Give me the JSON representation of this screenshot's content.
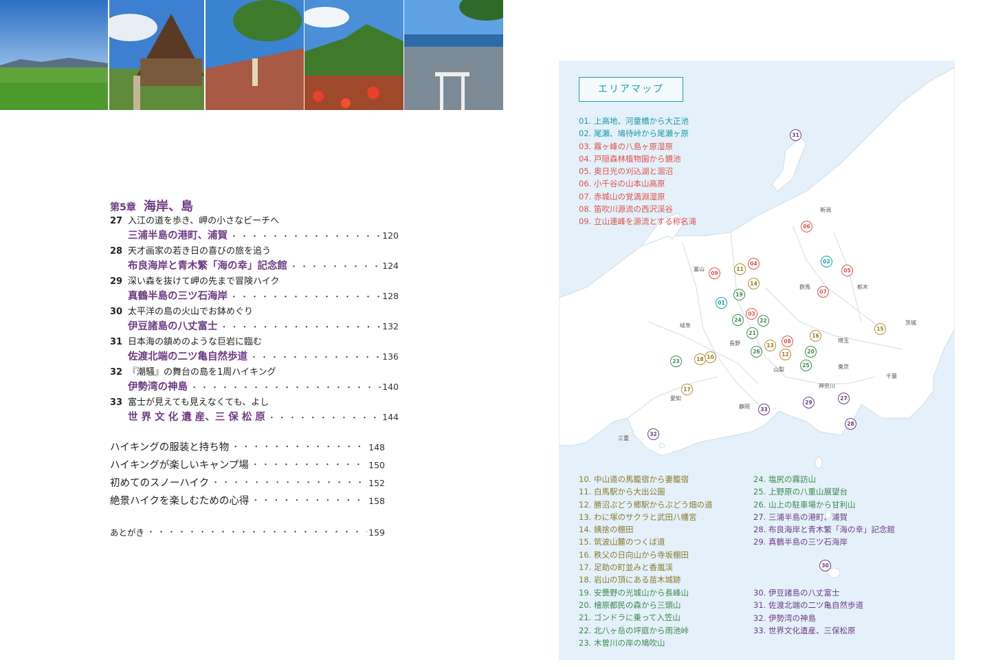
{
  "photos": [
    {
      "name": "rice-field-photo"
    },
    {
      "name": "mountain-lodge-photo"
    },
    {
      "name": "hikers-rock-photo"
    },
    {
      "name": "azalea-mountain-photo"
    },
    {
      "name": "harbor-shrine-photo"
    }
  ],
  "chapter": {
    "number": "第5章",
    "title": "海岸、島"
  },
  "entries": [
    {
      "n": "27",
      "sub": "入江の道を歩き、岬の小さなビーチへ",
      "main": "三浦半島の港町、浦賀",
      "page": "120"
    },
    {
      "n": "28",
      "sub": "天才画家の若き日の喜びの旅を追う",
      "main": "布良海岸と青木繁「海の幸」記念館",
      "page": "124"
    },
    {
      "n": "29",
      "sub": "深い森を抜けて岬の先まで冒険ハイク",
      "main": "真鶴半島の三ツ石海岸",
      "page": "128"
    },
    {
      "n": "30",
      "sub": "太平洋の島の火山でお鉢めぐり",
      "main": "伊豆諸島の八丈富士",
      "page": "132"
    },
    {
      "n": "31",
      "sub": "日本海の鎮めのような巨岩に臨む",
      "main": "佐渡北端の二ツ亀自然歩道",
      "page": "136"
    },
    {
      "n": "32",
      "sub": "『潮騒』の舞台の島を1周ハイキング",
      "main": "伊勢湾の神島",
      "page": "140"
    },
    {
      "n": "33",
      "sub": "富士が見えても見えなくても、よし",
      "main": "世 界 文 化 遺 産、三 保 松 原",
      "page": "144"
    }
  ],
  "extras": [
    {
      "label": "ハイキングの服装と持ち物",
      "page": "148"
    },
    {
      "label": "ハイキングが楽しいキャンプ場",
      "page": "150"
    },
    {
      "label": "初めてのスノーハイク",
      "page": "152"
    },
    {
      "label": "絶景ハイクを楽しむための心得",
      "page": "158"
    }
  ],
  "afterword": {
    "label": "あとがき",
    "page": "159"
  },
  "map": {
    "title": "エリアマップ",
    "legend_top": [
      {
        "text": "01. 上高地、河童橋から大正池",
        "color": "teal"
      },
      {
        "text": "02. 尾瀬、鳩待峠から尾瀬ヶ原",
        "color": "teal"
      },
      {
        "text": "03. 霧ヶ峰の八島ヶ原湿原",
        "color": "red"
      },
      {
        "text": "04. 戸隠森林植物園から鏡池",
        "color": "red"
      },
      {
        "text": "05. 奥日光の刈込湖と涸沼",
        "color": "red"
      },
      {
        "text": "06. 小千谷の山本山高原",
        "color": "red"
      },
      {
        "text": "07. 赤城山の覚満淵湿原",
        "color": "red"
      },
      {
        "text": "08. 笛吹川源流の西沢渓谷",
        "color": "red"
      },
      {
        "text": "09. 立山連峰を源流とする称名滝",
        "color": "red"
      }
    ],
    "legend_left": [
      {
        "text": "10. 中山道の馬籠宿から妻籠宿",
        "color": "olive"
      },
      {
        "text": "11. 白馬駅から大出公園",
        "color": "olive"
      },
      {
        "text": "12. 勝沼ぶどう郷駅からぶどう畑の道",
        "color": "olive"
      },
      {
        "text": "13. わに塚のサクラと武田八幡宮",
        "color": "olive"
      },
      {
        "text": "14. 姨捨の棚田",
        "color": "olive"
      },
      {
        "text": "15. 筑波山麓のつくば道",
        "color": "olive"
      },
      {
        "text": "16. 秩父の日向山から寺坂棚田",
        "color": "olive"
      },
      {
        "text": "17. 足助の町並みと香嵐渓",
        "color": "olive"
      },
      {
        "text": "18. 岩山の頂にある苗木城跡",
        "color": "olive"
      },
      {
        "text": "19. 安曇野の光城山から長峰山",
        "color": "green"
      },
      {
        "text": "20. 檜原都民の森から三頭山",
        "color": "green"
      },
      {
        "text": "21. ゴンドラに乗って入笠山",
        "color": "green"
      },
      {
        "text": "22. 北八ヶ岳の坪庭から雨池峠",
        "color": "green"
      },
      {
        "text": "23. 木曽川の岸の鳩吹山",
        "color": "green"
      }
    ],
    "legend_right_a": [
      {
        "text": "24. 塩尻の霧訪山",
        "color": "green"
      },
      {
        "text": "25. 上野原の八重山展望台",
        "color": "green"
      },
      {
        "text": "26. 山上の駐車場から甘利山",
        "color": "green"
      },
      {
        "text": "27. 三浦半島の港町、浦賀",
        "color": "purple"
      },
      {
        "text": "28. 布良海岸と青木繁「海の幸」記念館",
        "color": "purple"
      },
      {
        "text": "29. 真鶴半島の三ツ石海岸",
        "color": "purple"
      }
    ],
    "legend_right_b": [
      {
        "text": "30. 伊豆諸島の八丈富士",
        "color": "purple"
      },
      {
        "text": "31. 佐渡北端の二ツ亀自然歩道",
        "color": "purple"
      },
      {
        "text": "32. 伊勢湾の神島",
        "color": "purple"
      },
      {
        "text": "33. 世界文化遺産、三保松原",
        "color": "purple"
      }
    ],
    "prefectures": [
      "新潟",
      "富山",
      "群馬",
      "栃木",
      "岐阜",
      "長野",
      "埼玉",
      "茨城",
      "山梨",
      "東京",
      "千葉",
      "愛知",
      "神奈川",
      "静岡",
      "三重"
    ],
    "pins": [
      {
        "n": "01",
        "color": "teal"
      },
      {
        "n": "02",
        "color": "teal"
      },
      {
        "n": "03",
        "color": "red"
      },
      {
        "n": "04",
        "color": "red"
      },
      {
        "n": "05",
        "color": "red"
      },
      {
        "n": "06",
        "color": "red"
      },
      {
        "n": "07",
        "color": "red"
      },
      {
        "n": "08",
        "color": "red"
      },
      {
        "n": "09",
        "color": "red"
      },
      {
        "n": "10",
        "color": "olive"
      },
      {
        "n": "11",
        "color": "olive"
      },
      {
        "n": "12",
        "color": "olive"
      },
      {
        "n": "13",
        "color": "olive"
      },
      {
        "n": "14",
        "color": "olive"
      },
      {
        "n": "15",
        "color": "olive"
      },
      {
        "n": "16",
        "color": "olive"
      },
      {
        "n": "17",
        "color": "olive"
      },
      {
        "n": "18",
        "color": "olive"
      },
      {
        "n": "19",
        "color": "green"
      },
      {
        "n": "20",
        "color": "green"
      },
      {
        "n": "21",
        "color": "green"
      },
      {
        "n": "22",
        "color": "green"
      },
      {
        "n": "23",
        "color": "green"
      },
      {
        "n": "24",
        "color": "green"
      },
      {
        "n": "25",
        "color": "green"
      },
      {
        "n": "26",
        "color": "green"
      },
      {
        "n": "27",
        "color": "purple"
      },
      {
        "n": "28",
        "color": "purple"
      },
      {
        "n": "29",
        "color": "purple"
      },
      {
        "n": "30",
        "color": "purple"
      },
      {
        "n": "31",
        "color": "purple"
      },
      {
        "n": "32",
        "color": "purple"
      },
      {
        "n": "33",
        "color": "purple"
      }
    ]
  }
}
